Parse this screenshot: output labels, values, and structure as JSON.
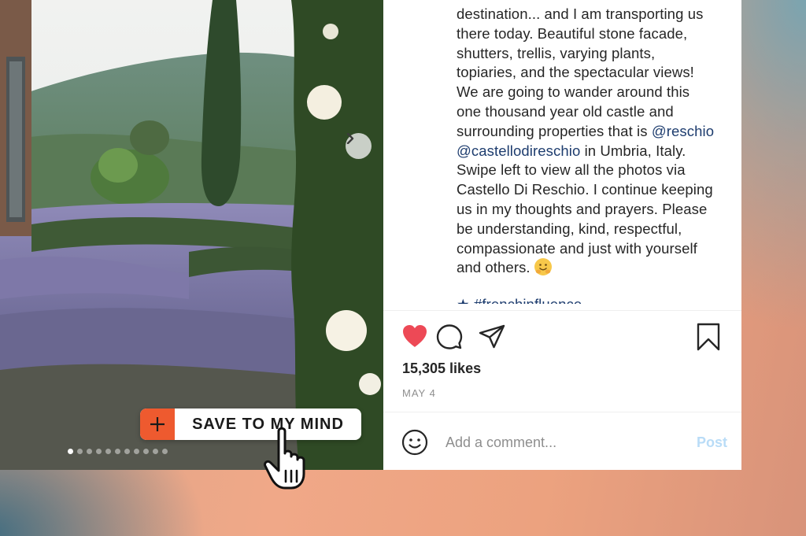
{
  "save_button": {
    "label": "SAVE TO MY MIND",
    "accent": "#ee5a2f"
  },
  "carousel": {
    "slide_count": 11,
    "active_index": 0,
    "next_icon": "chevron-right-icon"
  },
  "caption": {
    "line1": "destination... and I am transporting us",
    "line2": "there today. Beautiful stone facade,",
    "line3": "shutters, trellis, varying plants,",
    "line4": "topiaries, and the spectacular views!",
    "line5": "We are going to wander around this",
    "line6": "one thousand year old castle and",
    "line7_prefix": "surrounding properties that is ",
    "mention1": "@reschio",
    "mention2": "@castellodireschio",
    "line8_suffix": " in Umbria, Italy.",
    "line9": "Swipe left to view all the photos via",
    "line10": "Castello Di Reschio. I continue keeping",
    "line11": "us in my thoughts and prayers. Please",
    "line12": "be understanding, kind, respectful,",
    "line13": "compassionate and just with yourself",
    "line14": "and others.",
    "emoji": "hugging-face-emoji",
    "hashtag_bullet": "★",
    "hashtag": "#frenchinfluence",
    "link_color": "#1d3c6e"
  },
  "actions": {
    "like_icon": "heart-icon",
    "like_color": "#ed4956",
    "liked": true,
    "comment_icon": "comment-icon",
    "share_icon": "paper-plane-icon",
    "save_icon": "bookmark-icon"
  },
  "likes_text": "15,305 likes",
  "date_text": "MAY 4",
  "comment": {
    "placeholder": "Add a comment...",
    "post_label": "Post",
    "emoji_icon": "smiley-icon",
    "post_color": "#b9dcf7"
  }
}
